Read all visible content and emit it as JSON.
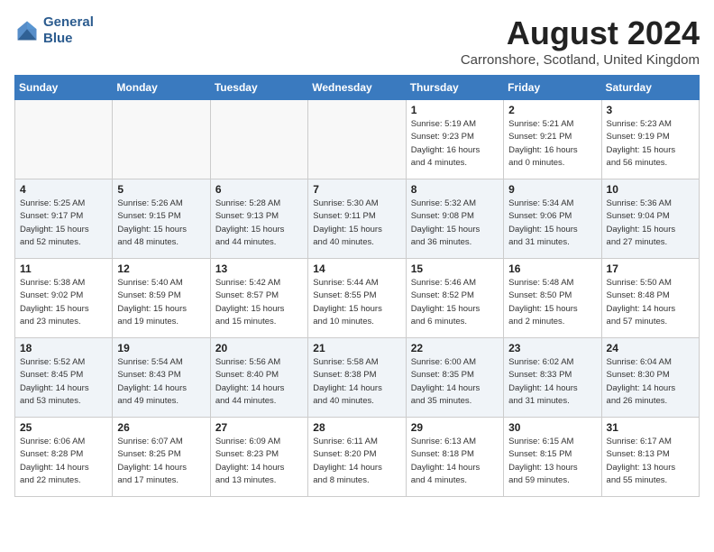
{
  "header": {
    "logo_line1": "General",
    "logo_line2": "Blue",
    "month_year": "August 2024",
    "location": "Carronshore, Scotland, United Kingdom"
  },
  "weekdays": [
    "Sunday",
    "Monday",
    "Tuesday",
    "Wednesday",
    "Thursday",
    "Friday",
    "Saturday"
  ],
  "weeks": [
    [
      {
        "day": "",
        "info": ""
      },
      {
        "day": "",
        "info": ""
      },
      {
        "day": "",
        "info": ""
      },
      {
        "day": "",
        "info": ""
      },
      {
        "day": "1",
        "info": "Sunrise: 5:19 AM\nSunset: 9:23 PM\nDaylight: 16 hours\nand 4 minutes."
      },
      {
        "day": "2",
        "info": "Sunrise: 5:21 AM\nSunset: 9:21 PM\nDaylight: 16 hours\nand 0 minutes."
      },
      {
        "day": "3",
        "info": "Sunrise: 5:23 AM\nSunset: 9:19 PM\nDaylight: 15 hours\nand 56 minutes."
      }
    ],
    [
      {
        "day": "4",
        "info": "Sunrise: 5:25 AM\nSunset: 9:17 PM\nDaylight: 15 hours\nand 52 minutes."
      },
      {
        "day": "5",
        "info": "Sunrise: 5:26 AM\nSunset: 9:15 PM\nDaylight: 15 hours\nand 48 minutes."
      },
      {
        "day": "6",
        "info": "Sunrise: 5:28 AM\nSunset: 9:13 PM\nDaylight: 15 hours\nand 44 minutes."
      },
      {
        "day": "7",
        "info": "Sunrise: 5:30 AM\nSunset: 9:11 PM\nDaylight: 15 hours\nand 40 minutes."
      },
      {
        "day": "8",
        "info": "Sunrise: 5:32 AM\nSunset: 9:08 PM\nDaylight: 15 hours\nand 36 minutes."
      },
      {
        "day": "9",
        "info": "Sunrise: 5:34 AM\nSunset: 9:06 PM\nDaylight: 15 hours\nand 31 minutes."
      },
      {
        "day": "10",
        "info": "Sunrise: 5:36 AM\nSunset: 9:04 PM\nDaylight: 15 hours\nand 27 minutes."
      }
    ],
    [
      {
        "day": "11",
        "info": "Sunrise: 5:38 AM\nSunset: 9:02 PM\nDaylight: 15 hours\nand 23 minutes."
      },
      {
        "day": "12",
        "info": "Sunrise: 5:40 AM\nSunset: 8:59 PM\nDaylight: 15 hours\nand 19 minutes."
      },
      {
        "day": "13",
        "info": "Sunrise: 5:42 AM\nSunset: 8:57 PM\nDaylight: 15 hours\nand 15 minutes."
      },
      {
        "day": "14",
        "info": "Sunrise: 5:44 AM\nSunset: 8:55 PM\nDaylight: 15 hours\nand 10 minutes."
      },
      {
        "day": "15",
        "info": "Sunrise: 5:46 AM\nSunset: 8:52 PM\nDaylight: 15 hours\nand 6 minutes."
      },
      {
        "day": "16",
        "info": "Sunrise: 5:48 AM\nSunset: 8:50 PM\nDaylight: 15 hours\nand 2 minutes."
      },
      {
        "day": "17",
        "info": "Sunrise: 5:50 AM\nSunset: 8:48 PM\nDaylight: 14 hours\nand 57 minutes."
      }
    ],
    [
      {
        "day": "18",
        "info": "Sunrise: 5:52 AM\nSunset: 8:45 PM\nDaylight: 14 hours\nand 53 minutes."
      },
      {
        "day": "19",
        "info": "Sunrise: 5:54 AM\nSunset: 8:43 PM\nDaylight: 14 hours\nand 49 minutes."
      },
      {
        "day": "20",
        "info": "Sunrise: 5:56 AM\nSunset: 8:40 PM\nDaylight: 14 hours\nand 44 minutes."
      },
      {
        "day": "21",
        "info": "Sunrise: 5:58 AM\nSunset: 8:38 PM\nDaylight: 14 hours\nand 40 minutes."
      },
      {
        "day": "22",
        "info": "Sunrise: 6:00 AM\nSunset: 8:35 PM\nDaylight: 14 hours\nand 35 minutes."
      },
      {
        "day": "23",
        "info": "Sunrise: 6:02 AM\nSunset: 8:33 PM\nDaylight: 14 hours\nand 31 minutes."
      },
      {
        "day": "24",
        "info": "Sunrise: 6:04 AM\nSunset: 8:30 PM\nDaylight: 14 hours\nand 26 minutes."
      }
    ],
    [
      {
        "day": "25",
        "info": "Sunrise: 6:06 AM\nSunset: 8:28 PM\nDaylight: 14 hours\nand 22 minutes."
      },
      {
        "day": "26",
        "info": "Sunrise: 6:07 AM\nSunset: 8:25 PM\nDaylight: 14 hours\nand 17 minutes."
      },
      {
        "day": "27",
        "info": "Sunrise: 6:09 AM\nSunset: 8:23 PM\nDaylight: 14 hours\nand 13 minutes."
      },
      {
        "day": "28",
        "info": "Sunrise: 6:11 AM\nSunset: 8:20 PM\nDaylight: 14 hours\nand 8 minutes."
      },
      {
        "day": "29",
        "info": "Sunrise: 6:13 AM\nSunset: 8:18 PM\nDaylight: 14 hours\nand 4 minutes."
      },
      {
        "day": "30",
        "info": "Sunrise: 6:15 AM\nSunset: 8:15 PM\nDaylight: 13 hours\nand 59 minutes."
      },
      {
        "day": "31",
        "info": "Sunrise: 6:17 AM\nSunset: 8:13 PM\nDaylight: 13 hours\nand 55 minutes."
      }
    ]
  ]
}
